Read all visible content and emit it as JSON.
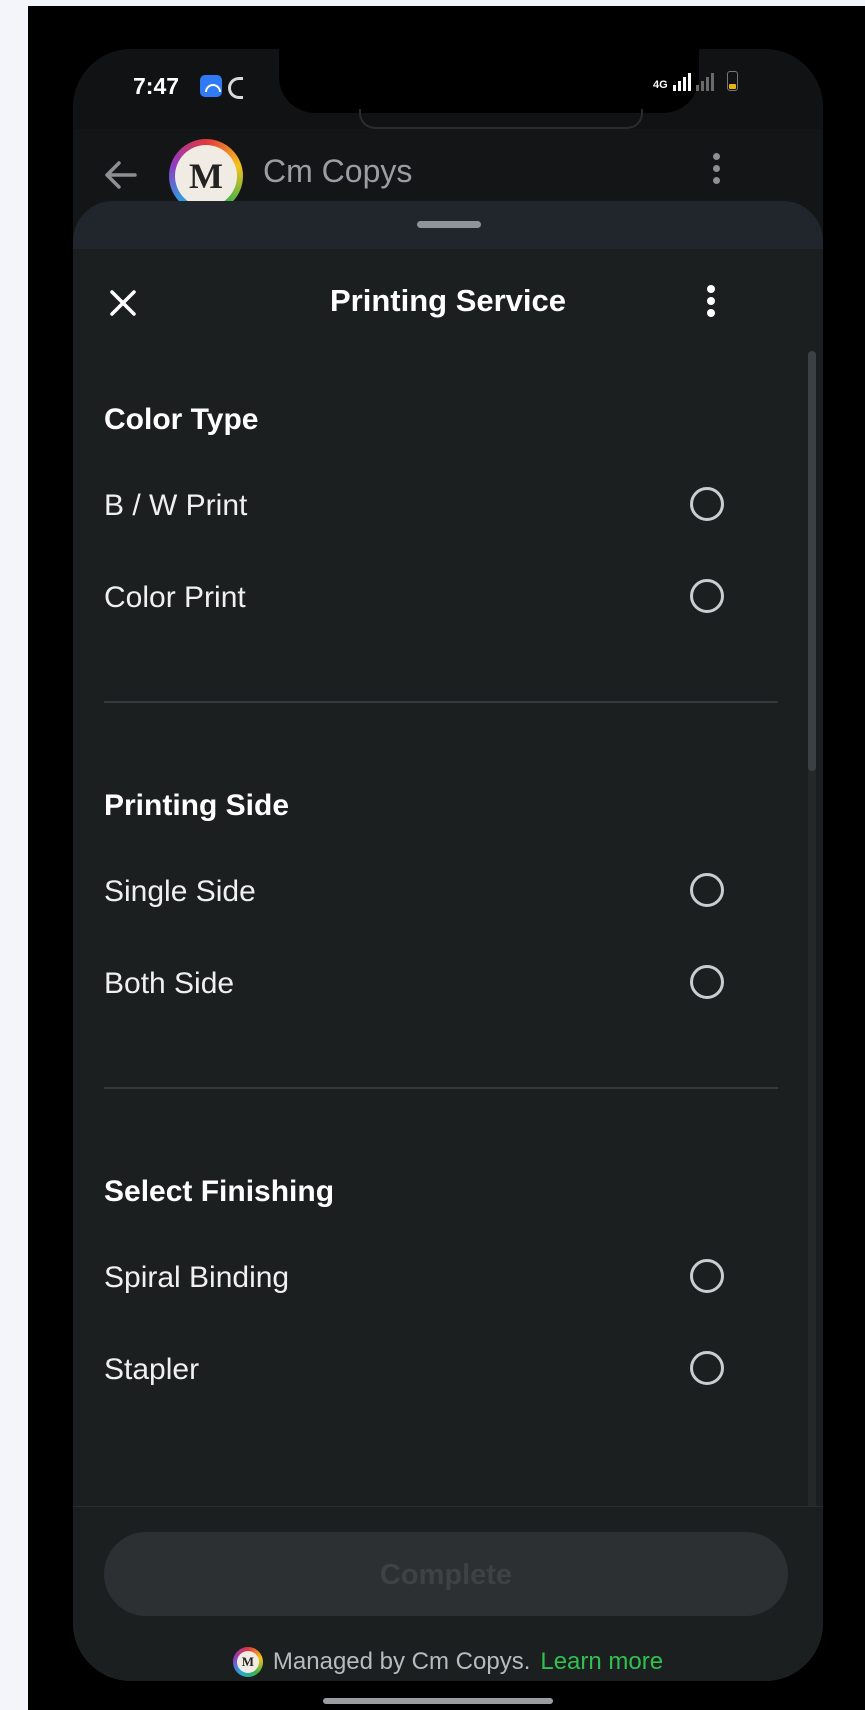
{
  "status_bar": {
    "time": "7:47",
    "network": "4G"
  },
  "chat_header": {
    "title": "Cm Copys",
    "logo_letter": "M"
  },
  "sheet": {
    "title": "Printing Service"
  },
  "sections": [
    {
      "title": "Color Type",
      "options": [
        {
          "label": "B / W Print",
          "selected": false
        },
        {
          "label": "Color Print",
          "selected": false
        }
      ]
    },
    {
      "title": "Printing Side",
      "options": [
        {
          "label": "Single Side",
          "selected": false
        },
        {
          "label": "Both Side",
          "selected": false
        }
      ]
    },
    {
      "title": "Select Finishing",
      "options": [
        {
          "label": "Spiral Binding",
          "selected": false
        },
        {
          "label": "Stapler",
          "selected": false
        }
      ]
    }
  ],
  "footer": {
    "complete_label": "Complete",
    "managed_text": "Managed by Cm Copys.",
    "learn_more": "Learn more",
    "logo_letter": "M"
  },
  "colors": {
    "accent_link": "#30c04f",
    "sheet_bg": "#1c1f20",
    "disabled_button": "#2d3032"
  },
  "icons": {
    "back": "back-arrow-icon",
    "close": "close-icon",
    "menu": "kebab-menu-icon",
    "radio": "radio-unchecked-icon"
  }
}
